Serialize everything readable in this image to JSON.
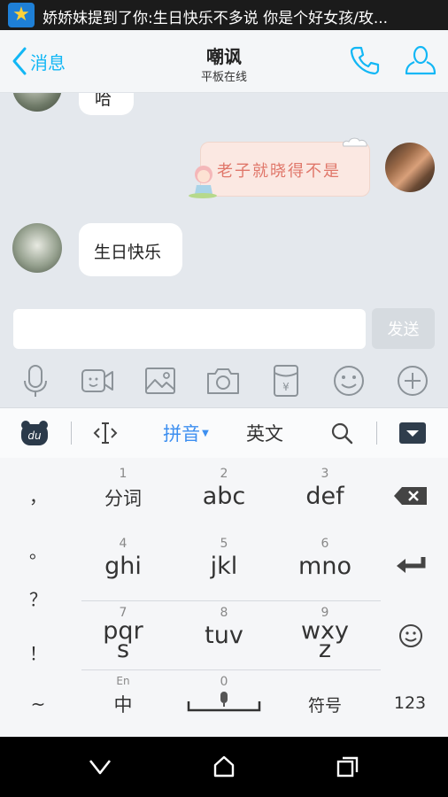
{
  "status_bar": {
    "notification": "娇娇妹提到了你:生日快乐不多说 你是个好女孩/玫..."
  },
  "header": {
    "back_label": "消息",
    "title": "嘲讽",
    "subtitle": "平板在线"
  },
  "messages": [
    {
      "side": "left",
      "text": "哈",
      "partial": true
    },
    {
      "side": "right",
      "text": "老子就晓得不是",
      "sticker": true
    },
    {
      "side": "left",
      "text": "生日快乐"
    }
  ],
  "composer": {
    "input_value": "",
    "send_label": "发送"
  },
  "toolbar_icons": [
    "microphone-icon",
    "video-icon",
    "image-icon",
    "camera-icon",
    "red-packet-icon",
    "emoji-icon",
    "plus-icon"
  ],
  "ime": {
    "toolbar": {
      "cursor_label": "",
      "pinyin_label": "拼音",
      "english_label": "英文"
    },
    "left_symbols": [
      "，",
      "。",
      "？",
      "！",
      "~"
    ],
    "keys": [
      {
        "num": "1",
        "label": "分词"
      },
      {
        "num": "2",
        "label": "abc"
      },
      {
        "num": "3",
        "label": "def"
      },
      {
        "num": "4",
        "label": "ghi"
      },
      {
        "num": "5",
        "label": "jkl"
      },
      {
        "num": "6",
        "label": "mno"
      },
      {
        "num": "7",
        "label": "pqr\ns"
      },
      {
        "num": "8",
        "label": "tuv"
      },
      {
        "num": "9",
        "label": "wxy\nz"
      }
    ],
    "bottom": {
      "lang_small": "En",
      "lang_big": "中",
      "space_num": "0",
      "symbols_label": "符号",
      "numbers_label": "123"
    }
  },
  "colors": {
    "accent": "#12b7f5",
    "status_bg": "#1b1b1b",
    "chat_bg": "#e4e8ed"
  }
}
